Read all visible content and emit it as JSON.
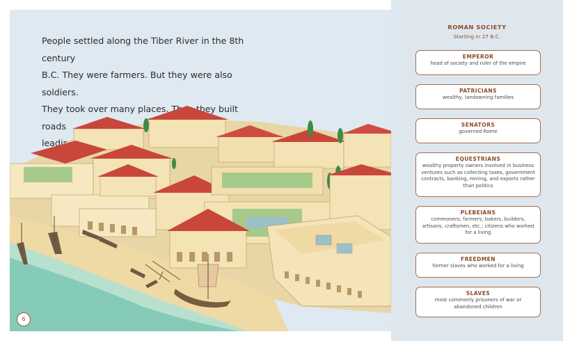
{
  "page": {
    "body_lines": [
      "People settled along the Tiber River in the 8th century",
      "B.C. They were farmers. But they were also soldiers.",
      "They took over many places. Then they built roads",
      "leading back to Rome."
    ],
    "page_number": "6"
  },
  "sidebar": {
    "title": "ROMAN SOCIETY",
    "subtitle": "Starting in 27 B.C.",
    "items": [
      {
        "title": "EMPEROR",
        "desc": "head of society and ruler of the empire"
      },
      {
        "title": "PATRICIANS",
        "desc": "wealthy, landowning families"
      },
      {
        "title": "SENATORS",
        "desc": "governed Rome"
      },
      {
        "title": "EQUESTRIANS",
        "desc": "wealthy property owners involved in business ventures such as collecting taxes, government contracts, banking, mining, and exports rather than politics"
      },
      {
        "title": "PLEBEIANS",
        "desc": "commoners; farmers, bakers, builders, artisans, craftsmen, etc.; citizens who worked for a living"
      },
      {
        "title": "FREEDMEN",
        "desc": "former slaves who worked for a living"
      },
      {
        "title": "SLAVES",
        "desc": "most commonly prisoners of war or abandoned children"
      }
    ]
  },
  "colors": {
    "accent": "#8b4d2c",
    "panel": "#dfe7ee",
    "sky": "#dfe9f1",
    "water": "#7fc6b3",
    "roof": "#c9463a",
    "wall": "#f3e3b5"
  }
}
